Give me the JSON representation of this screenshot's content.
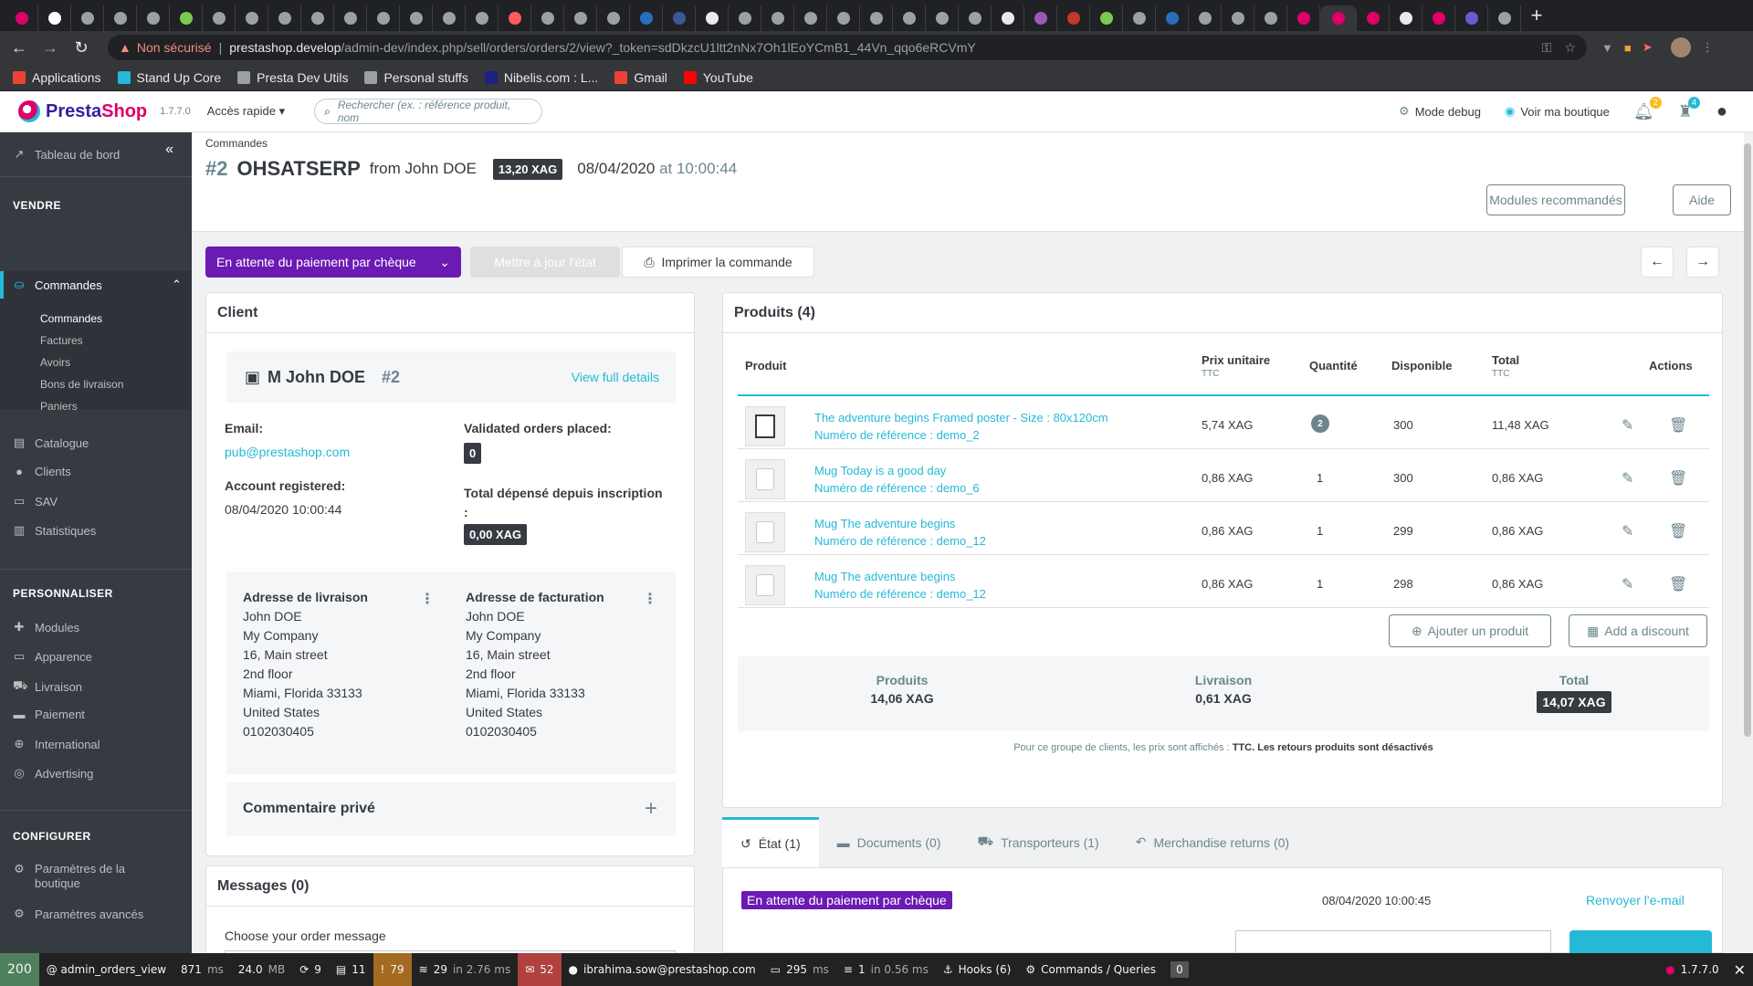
{
  "browser": {
    "tab_colors": [
      "#df0067",
      "#ffffff",
      "#9aa0a6",
      "#9aa0a6",
      "#9aa0a6",
      "#7ec850",
      "#9aa0a6",
      "#9aa0a6",
      "#9aa0a6",
      "#9aa0a6",
      "#9aa0a6",
      "#9aa0a6",
      "#9aa0a6",
      "#9aa0a6",
      "#9aa0a6",
      "#ff5c5c",
      "#9aa0a6",
      "#9aa0a6",
      "#9aa0a6",
      "#2a6ebb",
      "#3b5998",
      "#e8eaed",
      "#9aa0a6",
      "#9aa0a6",
      "#9aa0a6",
      "#9aa0a6",
      "#9aa0a6",
      "#9aa0a6",
      "#9aa0a6",
      "#9aa0a6",
      "#e8eaed",
      "#9b59b6",
      "#c0392b",
      "#7ec850",
      "#9aa0a6",
      "#2a6ebb",
      "#9aa0a6",
      "#9aa0a6",
      "#9aa0a6",
      "#df0067",
      "#df0067",
      "#df0067",
      "#e8eaed",
      "#df0067",
      "#6b5bd2",
      "#9aa0a6"
    ],
    "url_warning": "Non sécurisé",
    "url_host": "prestashop.develop",
    "url_path": "/admin-dev/index.php/sell/orders/orders/2/view?_token=sdDkzcU1ltt2nNx7Oh1lEoYCmB1_44Vn_qqo6eRCVmY",
    "bookmarks": [
      {
        "label": "Applications",
        "icon_color": "#ea4335"
      },
      {
        "label": "Stand Up Core",
        "icon_color": "#25b9d7"
      },
      {
        "label": "Presta Dev Utils",
        "icon_color": "#9aa0a6"
      },
      {
        "label": "Personal stuffs",
        "icon_color": "#9aa0a6"
      },
      {
        "label": "Nibelis.com : L...",
        "icon_color": "#1a237e"
      },
      {
        "label": "Gmail",
        "icon_color": "#ea4335"
      },
      {
        "label": "YouTube",
        "icon_color": "#ff0000"
      }
    ]
  },
  "header": {
    "logo_presta": "Presta",
    "logo_shop": "Shop",
    "version": "1.7.7.0",
    "quick_access": "Accès rapide",
    "search_placeholder": "Rechercher (ex. : référence produit, nom",
    "debug_mode": "Mode debug",
    "view_shop": "Voir ma boutique",
    "notif_orders": "2",
    "notif_customers": "4"
  },
  "sidebar": {
    "dashboard": "Tableau de bord",
    "sell_section": "VENDRE",
    "orders": "Commandes",
    "orders_sub": [
      "Commandes",
      "Factures",
      "Avoirs",
      "Bons de livraison",
      "Paniers"
    ],
    "catalog": "Catalogue",
    "customers": "Clients",
    "sav": "SAV",
    "stats": "Statistiques",
    "customize_section": "PERSONNALISER",
    "modules": "Modules",
    "appearance": "Apparence",
    "shipping": "Livraison",
    "payment": "Paiement",
    "international": "International",
    "advertising": "Advertising",
    "configure_section": "CONFIGURER",
    "shop_params_1": "Paramètres de la",
    "shop_params_2": "boutique",
    "advanced_params": "Paramètres avancés"
  },
  "page": {
    "breadcrumb": "Commandes",
    "order_num": "#2",
    "order_ref": "OHSATSERP",
    "from_label": "from John DOE",
    "order_total": "13,20 XAG",
    "order_date": "08/04/2020",
    "order_time": "at 10:00:44",
    "recommended_modules": "Modules recommandés",
    "help": "Aide"
  },
  "toolbar": {
    "status": "En attente du paiement par chèque",
    "update_status": "Mettre à jour l'état",
    "print_order": "Imprimer la commande"
  },
  "client": {
    "card_title": "Client",
    "name": "M John DOE",
    "id": "#2",
    "view_full": "View full details",
    "email_label": "Email:",
    "email": "pub@prestashop.com",
    "validated_label": "Validated orders placed:",
    "validated_count": "0",
    "registered_label": "Account registered:",
    "registered_date": "08/04/2020 10:00:44",
    "spent_label_1": "Total dépensé depuis inscription",
    "spent_label_2": ":",
    "spent_value": "0,00 XAG",
    "shipping_title": "Adresse de livraison",
    "billing_title": "Adresse de facturation",
    "address_lines": [
      "John DOE",
      "My Company",
      "16, Main street",
      "2nd floor",
      "Miami, Florida 33133",
      "United States",
      "0102030405"
    ],
    "private_comment": "Commentaire privé"
  },
  "messages": {
    "title": "Messages (0)",
    "choose": "Choose your order message"
  },
  "products": {
    "title": "Produits (4)",
    "headers": {
      "product": "Produit",
      "unit_price": "Prix unitaire",
      "unit_price_sub": "TTC",
      "qty": "Quantité",
      "available": "Disponible",
      "total": "Total",
      "total_sub": "TTC",
      "actions": "Actions"
    },
    "rows": [
      {
        "name": "The adventure begins Framed poster - Size : 80x120cm",
        "ref": "Numéro de référence : demo_2",
        "price": "5,74 XAG",
        "qty": "2",
        "available": "300",
        "total": "11,48 XAG"
      },
      {
        "name": "Mug Today is a good day",
        "ref": "Numéro de référence : demo_6",
        "price": "0,86 XAG",
        "qty": "1",
        "available": "300",
        "total": "0,86 XAG"
      },
      {
        "name": "Mug The adventure begins",
        "ref": "Numéro de référence : demo_12",
        "price": "0,86 XAG",
        "qty": "1",
        "available": "299",
        "total": "0,86 XAG"
      },
      {
        "name": "Mug The adventure begins",
        "ref": "Numéro de référence : demo_12",
        "price": "0,86 XAG",
        "qty": "1",
        "available": "298",
        "total": "0,86 XAG"
      }
    ],
    "add_product": "Ajouter un produit",
    "add_discount": "Add a discount",
    "totals": {
      "products_label": "Produits",
      "products_value": "14,06 XAG",
      "shipping_label": "Livraison",
      "shipping_value": "0,61 XAG",
      "total_label": "Total",
      "total_value": "14,07 XAG"
    },
    "note_prefix": "Pour ce groupe de clients, les prix sont affichés :",
    "note_ttc": "TTC.",
    "note_returns": "Les retours produits sont désactivés"
  },
  "order_tabs": {
    "state": "État (1)",
    "documents": "Documents (0)",
    "carriers": "Transporteurs (1)",
    "returns": "Merchandise returns (0)"
  },
  "history": {
    "status": "En attente du paiement par chèque",
    "date": "08/04/2020 10:00:45",
    "resend": "Renvoyer l'e-mail"
  },
  "debug_toolbar": {
    "status_code": "200",
    "route": "@ admin_orders_view",
    "time": "871",
    "time_unit": "ms",
    "memory": "24.0",
    "memory_unit": "MB",
    "forms": "9",
    "logs": "11",
    "warnings": "79",
    "db": "29",
    "db_time": "in 2.76 ms",
    "translations": "52",
    "user": "ibrahima.sow@prestashop.com",
    "twig": "295",
    "twig_unit": "ms",
    "cache": "1",
    "cache_time": "in 0.56 ms",
    "hooks": "Hooks (6)",
    "commands": "Commands / Queries",
    "cq_count": "0",
    "ps_version": "1.7.7.0"
  }
}
